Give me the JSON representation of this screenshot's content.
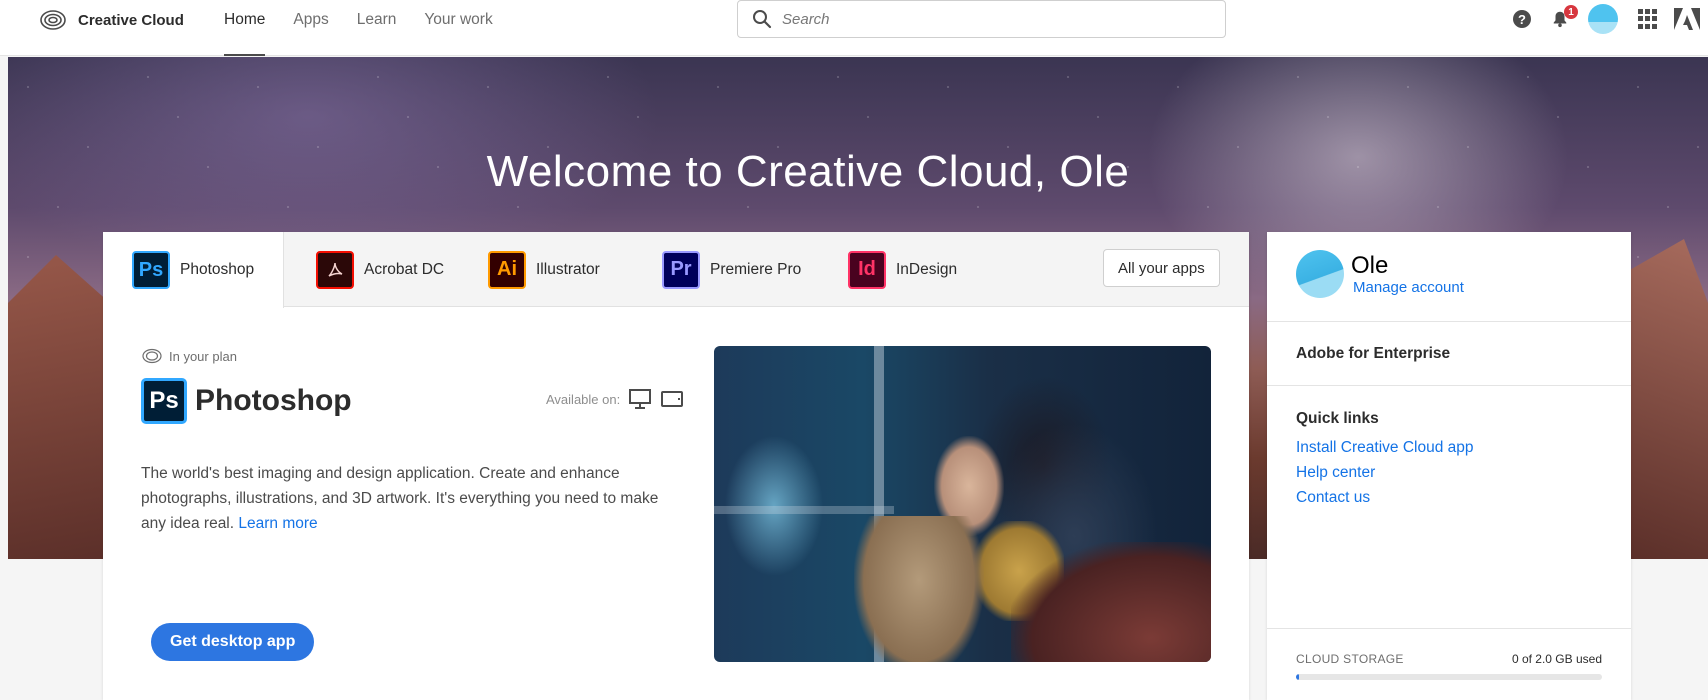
{
  "header": {
    "brand": "Creative Cloud",
    "nav": [
      {
        "label": "Home",
        "active": true
      },
      {
        "label": "Apps",
        "active": false
      },
      {
        "label": "Learn",
        "active": false
      },
      {
        "label": "Your work",
        "active": false
      }
    ],
    "search_placeholder": "Search",
    "notification_count": "1",
    "icons": [
      "help-icon",
      "bell-icon",
      "avatar",
      "apps-grid-icon",
      "adobe-logo-icon"
    ]
  },
  "hero": {
    "title": "Welcome to Creative Cloud, Ole"
  },
  "app_tabs": [
    {
      "abbr": "Ps",
      "label": "Photoshop",
      "bg": "#001e36",
      "border": "#31a8ff",
      "fg": "#31a8ff",
      "active": true
    },
    {
      "abbr": "",
      "label": "Acrobat DC",
      "bg": "#2b0808",
      "border": "#f40f02",
      "fg": "#f6d5d2",
      "active": false
    },
    {
      "abbr": "Ai",
      "label": "Illustrator",
      "bg": "#330000",
      "border": "#ff9a00",
      "fg": "#ff9a00",
      "active": false
    },
    {
      "abbr": "Pr",
      "label": "Premiere Pro",
      "bg": "#00005b",
      "border": "#9999ff",
      "fg": "#9999ff",
      "active": false
    },
    {
      "abbr": "Id",
      "label": "InDesign",
      "bg": "#49021f",
      "border": "#ff3366",
      "fg": "#ff3366",
      "active": false
    }
  ],
  "all_apps_label": "All your apps",
  "featured": {
    "in_plan": "In your plan",
    "abbr": "Ps",
    "name": "Photoshop",
    "available_on": "Available on:",
    "description": "The world's best imaging and design application. Create and enhance photographs, illustrations, and 3D artwork. It's everything you need to make any idea real.",
    "learn_more": "Learn more",
    "cta": "Get desktop app"
  },
  "sidebar": {
    "user_name": "Ole",
    "manage_account": "Manage account",
    "enterprise": "Adobe for Enterprise",
    "quick_links_title": "Quick links",
    "quick_links": [
      "Install Creative Cloud app",
      "Help center",
      "Contact us"
    ],
    "storage_label": "CLOUD STORAGE",
    "storage_used": "0 of 2.0 GB used",
    "storage_fraction": 0.0
  },
  "colors": {
    "accent": "#2d76e1",
    "link": "#1473e6",
    "photoshop_blue": "#31a8ff"
  }
}
